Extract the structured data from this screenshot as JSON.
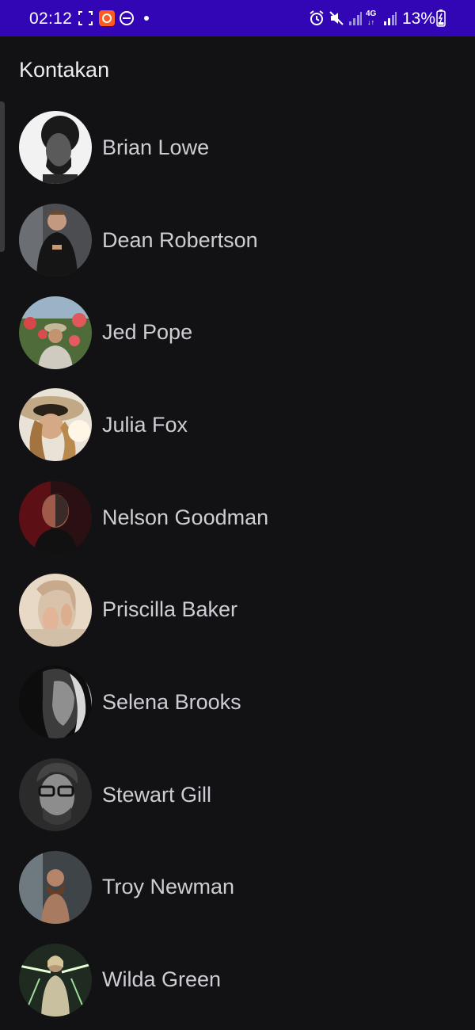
{
  "status_bar": {
    "time": "02:12",
    "battery": "13%",
    "network": "4G",
    "icons": [
      "screenshot-icon",
      "app-notification-icon",
      "dnd-icon",
      "dot-icon",
      "alarm-icon",
      "mute-icon",
      "signal-icon",
      "4g-signal-icon",
      "battery-icon"
    ],
    "background": "#3205b5"
  },
  "header": {
    "title": "Kontakan"
  },
  "contacts": [
    {
      "name": "Brian Lowe"
    },
    {
      "name": "Dean Robertson"
    },
    {
      "name": "Jed Pope"
    },
    {
      "name": "Julia Fox"
    },
    {
      "name": "Nelson Goodman"
    },
    {
      "name": "Priscilla Baker"
    },
    {
      "name": "Selena Brooks"
    },
    {
      "name": "Stewart Gill"
    },
    {
      "name": "Troy Newman"
    },
    {
      "name": "Wilda Green"
    }
  ],
  "colors": {
    "background": "#121114",
    "title_text": "#ececee",
    "name_text": "#cfcdd4"
  }
}
